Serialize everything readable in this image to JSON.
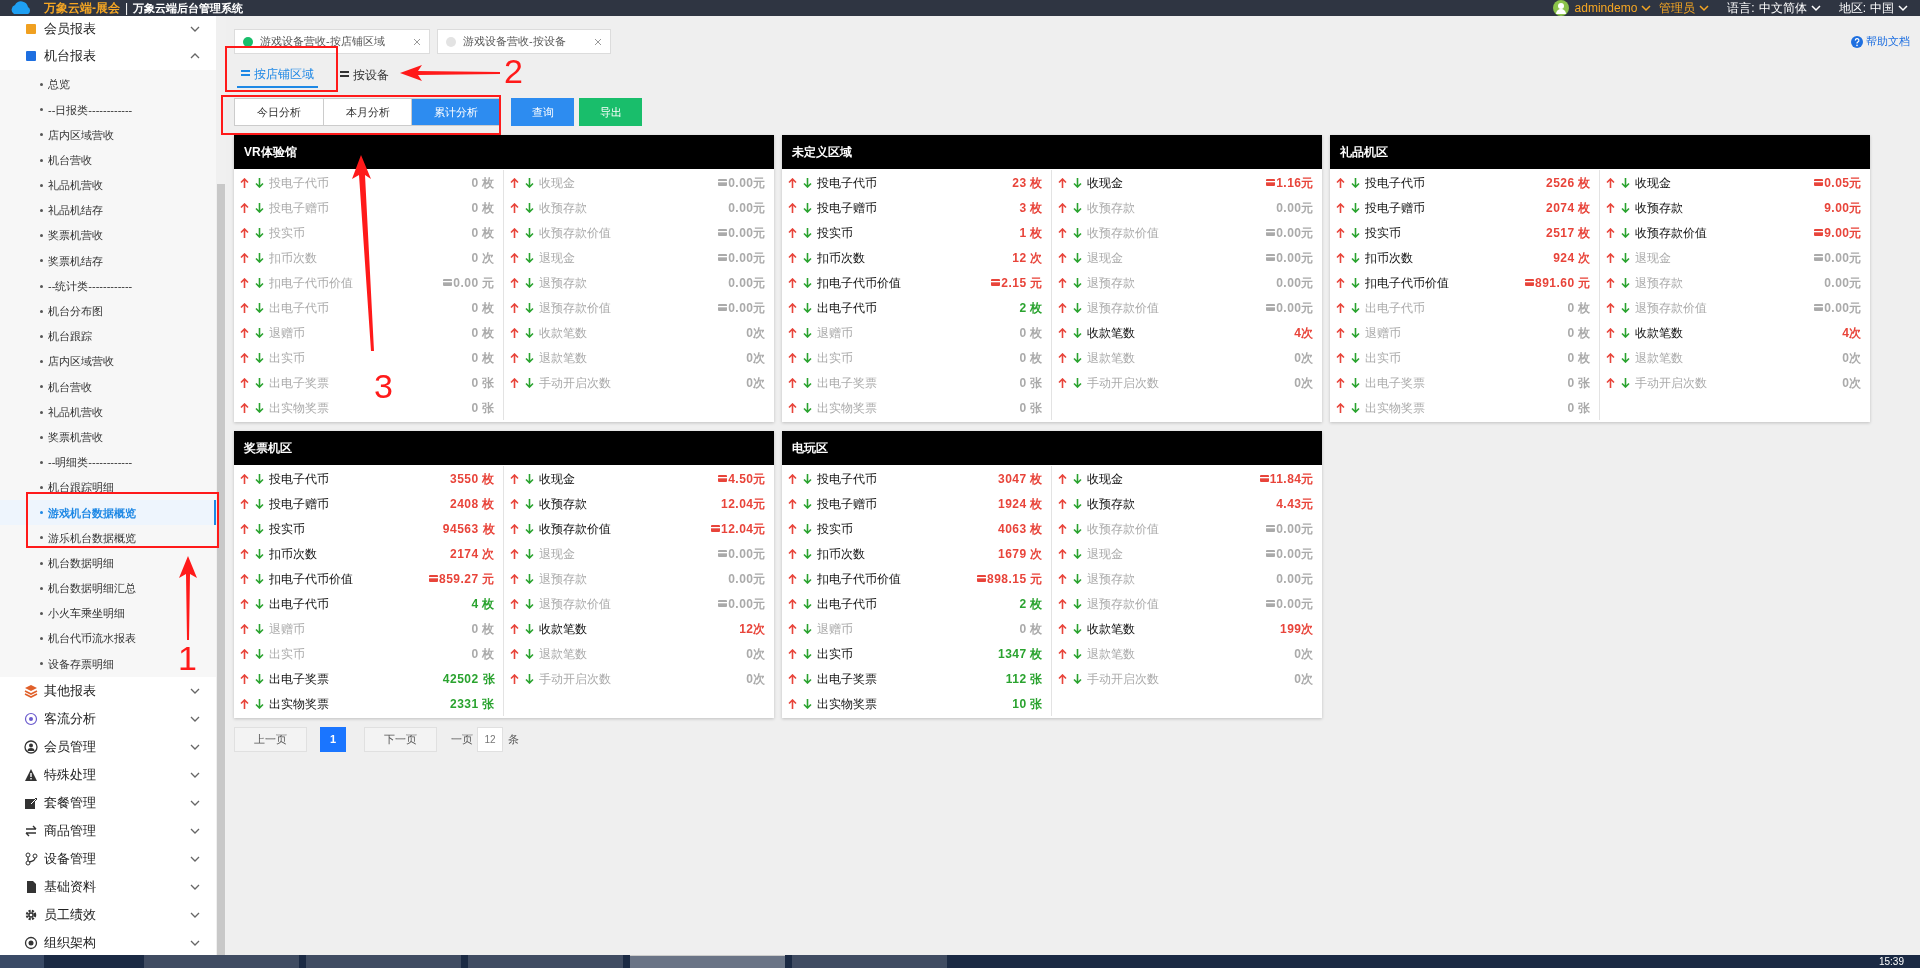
{
  "header": {
    "brand": "万象云端-展会",
    "separator": "|",
    "system": "万象云端后台管理系统",
    "user": "admindemo",
    "role": "管理员",
    "language_label": "语言:",
    "language": "中文简体",
    "region_label": "地区:",
    "region": "中国"
  },
  "sidebar": {
    "groups": [
      {
        "label": "会员报表",
        "expanded": false
      },
      {
        "label": "机台报表",
        "expanded": true,
        "children": [
          {
            "label": "总览",
            "selected": false
          },
          {
            "label": "--日报类------------",
            "selected": false
          },
          {
            "label": "店内区域营收",
            "selected": false
          },
          {
            "label": "机台营收",
            "selected": false
          },
          {
            "label": "礼品机营收",
            "selected": false
          },
          {
            "label": "礼品机结存",
            "selected": false
          },
          {
            "label": "奖票机营收",
            "selected": false
          },
          {
            "label": "奖票机结存",
            "selected": false
          },
          {
            "label": "--统计类------------",
            "selected": false
          },
          {
            "label": "机台分布图",
            "selected": false
          },
          {
            "label": "机台跟踪",
            "selected": false
          },
          {
            "label": "店内区域营收",
            "selected": false
          },
          {
            "label": "机台营收",
            "selected": false
          },
          {
            "label": "礼品机营收",
            "selected": false
          },
          {
            "label": "奖票机营收",
            "selected": false
          },
          {
            "label": "--明细类------------",
            "selected": false
          },
          {
            "label": "机台跟踪明细",
            "selected": false
          },
          {
            "label": "游戏机台数据概览",
            "selected": true
          },
          {
            "label": "游乐机台数据概览",
            "selected": false
          },
          {
            "label": "机台数据明细",
            "selected": false
          },
          {
            "label": "机台数据明细汇总",
            "selected": false
          },
          {
            "label": "小火车乘坐明细",
            "selected": false
          },
          {
            "label": "机台代币流水报表",
            "selected": false
          },
          {
            "label": "设备存票明细",
            "selected": false
          }
        ]
      },
      {
        "label": "其他报表",
        "expanded": false
      },
      {
        "label": "客流分析",
        "expanded": false
      },
      {
        "label": "会员管理",
        "expanded": false
      },
      {
        "label": "特殊处理",
        "expanded": false
      },
      {
        "label": "套餐管理",
        "expanded": false
      },
      {
        "label": "商品管理",
        "expanded": false
      },
      {
        "label": "设备管理",
        "expanded": false
      },
      {
        "label": "基础资料",
        "expanded": false
      },
      {
        "label": "员工绩效",
        "expanded": false
      },
      {
        "label": "组织架构",
        "expanded": false
      }
    ]
  },
  "page_tabs": [
    {
      "label": "游戏设备营收-按店铺区域",
      "selected": true
    },
    {
      "label": "游戏设备营收-按设备",
      "selected": false
    }
  ],
  "help": "帮助文档",
  "view_tabs": [
    {
      "label": "按店铺区域",
      "selected": true
    },
    {
      "label": "按设备",
      "selected": false
    }
  ],
  "periods": [
    {
      "label": "今日分析",
      "selected": false
    },
    {
      "label": "本月分析",
      "selected": false
    },
    {
      "label": "累计分析",
      "selected": true
    }
  ],
  "actions": [
    {
      "label": "查询",
      "kind": "primary"
    },
    {
      "label": "导出",
      "kind": "success"
    }
  ],
  "cards": [
    {
      "title": "VR体验馆",
      "left": [
        {
          "label": "投电子代币",
          "value": "0 枚",
          "color": "#aaaaaa",
          "dimmed": true,
          "card_icon": false
        },
        {
          "label": "投电子赠币",
          "value": "0 枚",
          "color": "#aaaaaa",
          "dimmed": true,
          "card_icon": false
        },
        {
          "label": "投实币",
          "value": "0 枚",
          "color": "#aaaaaa",
          "dimmed": true,
          "card_icon": false
        },
        {
          "label": "扣币次数",
          "value": "0 次",
          "color": "#aaaaaa",
          "dimmed": true,
          "card_icon": false
        },
        {
          "label": "扣电子代币价值",
          "value": "0.00 元",
          "color": "#aaaaaa",
          "dimmed": true,
          "card_icon": true
        },
        {
          "label": "出电子代币",
          "value": "0 枚",
          "color": "#aaaaaa",
          "dimmed": true,
          "card_icon": false
        },
        {
          "label": "退赠币",
          "value": "0 枚",
          "color": "#aaaaaa",
          "dimmed": true,
          "card_icon": false
        },
        {
          "label": "出实币",
          "value": "0 枚",
          "color": "#aaaaaa",
          "dimmed": true,
          "card_icon": false
        },
        {
          "label": "出电子奖票",
          "value": "0 张",
          "color": "#aaaaaa",
          "dimmed": true,
          "card_icon": false
        },
        {
          "label": "出实物奖票",
          "value": "0 张",
          "color": "#aaaaaa",
          "dimmed": true,
          "card_icon": false
        }
      ],
      "right": [
        {
          "label": "收现金",
          "value": "0.00元",
          "color": "#aaaaaa",
          "dimmed": true,
          "card_icon": true
        },
        {
          "label": "收预存款",
          "value": "0.00元",
          "color": "#aaaaaa",
          "dimmed": true,
          "card_icon": false
        },
        {
          "label": "收预存款价值",
          "value": "0.00元",
          "color": "#aaaaaa",
          "dimmed": true,
          "card_icon": true
        },
        {
          "label": "退现金",
          "value": "0.00元",
          "color": "#aaaaaa",
          "dimmed": true,
          "card_icon": true
        },
        {
          "label": "退预存款",
          "value": "0.00元",
          "color": "#aaaaaa",
          "dimmed": true,
          "card_icon": false
        },
        {
          "label": "退预存款价值",
          "value": "0.00元",
          "color": "#aaaaaa",
          "dimmed": true,
          "card_icon": true
        },
        {
          "label": "收款笔数",
          "value": "0次",
          "color": "#aaaaaa",
          "dimmed": true,
          "card_icon": false
        },
        {
          "label": "退款笔数",
          "value": "0次",
          "color": "#aaaaaa",
          "dimmed": true,
          "card_icon": false
        },
        {
          "label": "手动开启次数",
          "value": "0次",
          "color": "#aaaaaa",
          "dimmed": true,
          "card_icon": false
        }
      ]
    },
    {
      "title": "未定义区域",
      "left": [
        {
          "label": "投电子代币",
          "value": "23 枚",
          "color": "#e8443a",
          "dimmed": false,
          "card_icon": false
        },
        {
          "label": "投电子赠币",
          "value": "3 枚",
          "color": "#e8443a",
          "dimmed": false,
          "card_icon": false
        },
        {
          "label": "投实币",
          "value": "1 枚",
          "color": "#e8443a",
          "dimmed": false,
          "card_icon": false
        },
        {
          "label": "扣币次数",
          "value": "12 次",
          "color": "#e8443a",
          "dimmed": false,
          "card_icon": false
        },
        {
          "label": "扣电子代币价值",
          "value": "2.15 元",
          "color": "#e8443a",
          "dimmed": false,
          "card_icon": true
        },
        {
          "label": "出电子代币",
          "value": "2 枚",
          "color": "#2aa32f",
          "dimmed": false,
          "card_icon": false
        },
        {
          "label": "退赠币",
          "value": "0 枚",
          "color": "#aaaaaa",
          "dimmed": true,
          "card_icon": false
        },
        {
          "label": "出实币",
          "value": "0 枚",
          "color": "#aaaaaa",
          "dimmed": true,
          "card_icon": false
        },
        {
          "label": "出电子奖票",
          "value": "0 张",
          "color": "#aaaaaa",
          "dimmed": true,
          "card_icon": false
        },
        {
          "label": "出实物奖票",
          "value": "0 张",
          "color": "#aaaaaa",
          "dimmed": true,
          "card_icon": false
        }
      ],
      "right": [
        {
          "label": "收现金",
          "value": "1.16元",
          "color": "#e8443a",
          "dimmed": false,
          "card_icon": true
        },
        {
          "label": "收预存款",
          "value": "0.00元",
          "color": "#aaaaaa",
          "dimmed": true,
          "card_icon": false
        },
        {
          "label": "收预存款价值",
          "value": "0.00元",
          "color": "#aaaaaa",
          "dimmed": true,
          "card_icon": true
        },
        {
          "label": "退现金",
          "value": "0.00元",
          "color": "#aaaaaa",
          "dimmed": true,
          "card_icon": true
        },
        {
          "label": "退预存款",
          "value": "0.00元",
          "color": "#aaaaaa",
          "dimmed": true,
          "card_icon": false
        },
        {
          "label": "退预存款价值",
          "value": "0.00元",
          "color": "#aaaaaa",
          "dimmed": true,
          "card_icon": true
        },
        {
          "label": "收款笔数",
          "value": "4次",
          "color": "#e8443a",
          "dimmed": false,
          "card_icon": false
        },
        {
          "label": "退款笔数",
          "value": "0次",
          "color": "#aaaaaa",
          "dimmed": true,
          "card_icon": false
        },
        {
          "label": "手动开启次数",
          "value": "0次",
          "color": "#aaaaaa",
          "dimmed": true,
          "card_icon": false
        }
      ]
    },
    {
      "title": "礼品机区",
      "left": [
        {
          "label": "投电子代币",
          "value": "2526 枚",
          "color": "#e8443a",
          "dimmed": false,
          "card_icon": false
        },
        {
          "label": "投电子赠币",
          "value": "2074 枚",
          "color": "#e8443a",
          "dimmed": false,
          "card_icon": false
        },
        {
          "label": "投实币",
          "value": "2517 枚",
          "color": "#e8443a",
          "dimmed": false,
          "card_icon": false
        },
        {
          "label": "扣币次数",
          "value": "924 次",
          "color": "#e8443a",
          "dimmed": false,
          "card_icon": false
        },
        {
          "label": "扣电子代币价值",
          "value": "891.60 元",
          "color": "#e8443a",
          "dimmed": false,
          "card_icon": true
        },
        {
          "label": "出电子代币",
          "value": "0 枚",
          "color": "#aaaaaa",
          "dimmed": true,
          "card_icon": false
        },
        {
          "label": "退赠币",
          "value": "0 枚",
          "color": "#aaaaaa",
          "dimmed": true,
          "card_icon": false
        },
        {
          "label": "出实币",
          "value": "0 枚",
          "color": "#aaaaaa",
          "dimmed": true,
          "card_icon": false
        },
        {
          "label": "出电子奖票",
          "value": "0 张",
          "color": "#aaaaaa",
          "dimmed": true,
          "card_icon": false
        },
        {
          "label": "出实物奖票",
          "value": "0 张",
          "color": "#aaaaaa",
          "dimmed": true,
          "card_icon": false
        }
      ],
      "right": [
        {
          "label": "收现金",
          "value": "0.05元",
          "color": "#e8443a",
          "dimmed": false,
          "card_icon": true
        },
        {
          "label": "收预存款",
          "value": "9.00元",
          "color": "#e8443a",
          "dimmed": false,
          "card_icon": false
        },
        {
          "label": "收预存款价值",
          "value": "9.00元",
          "color": "#e8443a",
          "dimmed": false,
          "card_icon": true
        },
        {
          "label": "退现金",
          "value": "0.00元",
          "color": "#aaaaaa",
          "dimmed": true,
          "card_icon": true
        },
        {
          "label": "退预存款",
          "value": "0.00元",
          "color": "#aaaaaa",
          "dimmed": true,
          "card_icon": false
        },
        {
          "label": "退预存款价值",
          "value": "0.00元",
          "color": "#aaaaaa",
          "dimmed": true,
          "card_icon": true
        },
        {
          "label": "收款笔数",
          "value": "4次",
          "color": "#e8443a",
          "dimmed": false,
          "card_icon": false
        },
        {
          "label": "退款笔数",
          "value": "0次",
          "color": "#aaaaaa",
          "dimmed": true,
          "card_icon": false
        },
        {
          "label": "手动开启次数",
          "value": "0次",
          "color": "#aaaaaa",
          "dimmed": true,
          "card_icon": false
        }
      ]
    },
    {
      "title": "奖票机区",
      "left": [
        {
          "label": "投电子代币",
          "value": "3550 枚",
          "color": "#e8443a",
          "dimmed": false,
          "card_icon": false
        },
        {
          "label": "投电子赠币",
          "value": "2408 枚",
          "color": "#e8443a",
          "dimmed": false,
          "card_icon": false
        },
        {
          "label": "投实币",
          "value": "94563 枚",
          "color": "#e8443a",
          "dimmed": false,
          "card_icon": false
        },
        {
          "label": "扣币次数",
          "value": "2174 次",
          "color": "#e8443a",
          "dimmed": false,
          "card_icon": false
        },
        {
          "label": "扣电子代币价值",
          "value": "859.27 元",
          "color": "#e8443a",
          "dimmed": false,
          "card_icon": true
        },
        {
          "label": "出电子代币",
          "value": "4 枚",
          "color": "#2aa32f",
          "dimmed": false,
          "card_icon": false
        },
        {
          "label": "退赠币",
          "value": "0 枚",
          "color": "#aaaaaa",
          "dimmed": true,
          "card_icon": false
        },
        {
          "label": "出实币",
          "value": "0 枚",
          "color": "#aaaaaa",
          "dimmed": true,
          "card_icon": false
        },
        {
          "label": "出电子奖票",
          "value": "42502 张",
          "color": "#2aa32f",
          "dimmed": false,
          "card_icon": false
        },
        {
          "label": "出实物奖票",
          "value": "2331 张",
          "color": "#2aa32f",
          "dimmed": false,
          "card_icon": false
        }
      ],
      "right": [
        {
          "label": "收现金",
          "value": "4.50元",
          "color": "#e8443a",
          "dimmed": false,
          "card_icon": true
        },
        {
          "label": "收预存款",
          "value": "12.04元",
          "color": "#e8443a",
          "dimmed": false,
          "card_icon": false
        },
        {
          "label": "收预存款价值",
          "value": "12.04元",
          "color": "#e8443a",
          "dimmed": false,
          "card_icon": true
        },
        {
          "label": "退现金",
          "value": "0.00元",
          "color": "#aaaaaa",
          "dimmed": true,
          "card_icon": true
        },
        {
          "label": "退预存款",
          "value": "0.00元",
          "color": "#aaaaaa",
          "dimmed": true,
          "card_icon": false
        },
        {
          "label": "退预存款价值",
          "value": "0.00元",
          "color": "#aaaaaa",
          "dimmed": true,
          "card_icon": true
        },
        {
          "label": "收款笔数",
          "value": "12次",
          "color": "#e8443a",
          "dimmed": false,
          "card_icon": false
        },
        {
          "label": "退款笔数",
          "value": "0次",
          "color": "#aaaaaa",
          "dimmed": true,
          "card_icon": false
        },
        {
          "label": "手动开启次数",
          "value": "0次",
          "color": "#aaaaaa",
          "dimmed": true,
          "card_icon": false
        }
      ]
    },
    {
      "title": "电玩区",
      "left": [
        {
          "label": "投电子代币",
          "value": "3047 枚",
          "color": "#e8443a",
          "dimmed": false,
          "card_icon": false
        },
        {
          "label": "投电子赠币",
          "value": "1924 枚",
          "color": "#e8443a",
          "dimmed": false,
          "card_icon": false
        },
        {
          "label": "投实币",
          "value": "4063 枚",
          "color": "#e8443a",
          "dimmed": false,
          "card_icon": false
        },
        {
          "label": "扣币次数",
          "value": "1679 次",
          "color": "#e8443a",
          "dimmed": false,
          "card_icon": false
        },
        {
          "label": "扣电子代币价值",
          "value": "898.15 元",
          "color": "#e8443a",
          "dimmed": false,
          "card_icon": true
        },
        {
          "label": "出电子代币",
          "value": "2 枚",
          "color": "#2aa32f",
          "dimmed": false,
          "card_icon": false
        },
        {
          "label": "退赠币",
          "value": "0 枚",
          "color": "#aaaaaa",
          "dimmed": true,
          "card_icon": false
        },
        {
          "label": "出实币",
          "value": "1347 枚",
          "color": "#2aa32f",
          "dimmed": false,
          "card_icon": false
        },
        {
          "label": "出电子奖票",
          "value": "112 张",
          "color": "#2aa32f",
          "dimmed": false,
          "card_icon": false
        },
        {
          "label": "出实物奖票",
          "value": "10 张",
          "color": "#2aa32f",
          "dimmed": false,
          "card_icon": false
        }
      ],
      "right": [
        {
          "label": "收现金",
          "value": "11.84元",
          "color": "#e8443a",
          "dimmed": false,
          "card_icon": true
        },
        {
          "label": "收预存款",
          "value": "4.43元",
          "color": "#e8443a",
          "dimmed": false,
          "card_icon": false
        },
        {
          "label": "收预存款价值",
          "value": "0.00元",
          "color": "#aaaaaa",
          "dimmed": true,
          "card_icon": true
        },
        {
          "label": "退现金",
          "value": "0.00元",
          "color": "#aaaaaa",
          "dimmed": true,
          "card_icon": true
        },
        {
          "label": "退预存款",
          "value": "0.00元",
          "color": "#aaaaaa",
          "dimmed": true,
          "card_icon": false
        },
        {
          "label": "退预存款价值",
          "value": "0.00元",
          "color": "#aaaaaa",
          "dimmed": true,
          "card_icon": true
        },
        {
          "label": "收款笔数",
          "value": "199次",
          "color": "#e8443a",
          "dimmed": false,
          "card_icon": false
        },
        {
          "label": "退款笔数",
          "value": "0次",
          "color": "#aaaaaa",
          "dimmed": true,
          "card_icon": false
        },
        {
          "label": "手动开启次数",
          "value": "0次",
          "color": "#aaaaaa",
          "dimmed": true,
          "card_icon": false
        }
      ]
    }
  ],
  "pagination": {
    "prev": "上一页",
    "pages": [
      {
        "label": "1",
        "selected": true
      }
    ],
    "next": "下一页",
    "per_page_label": "一页",
    "per_page": "12",
    "unit": "条"
  },
  "annotations": [
    {
      "label": "1"
    },
    {
      "label": "2"
    },
    {
      "label": "3"
    }
  ],
  "taskbar": {
    "clock": "15:39"
  }
}
